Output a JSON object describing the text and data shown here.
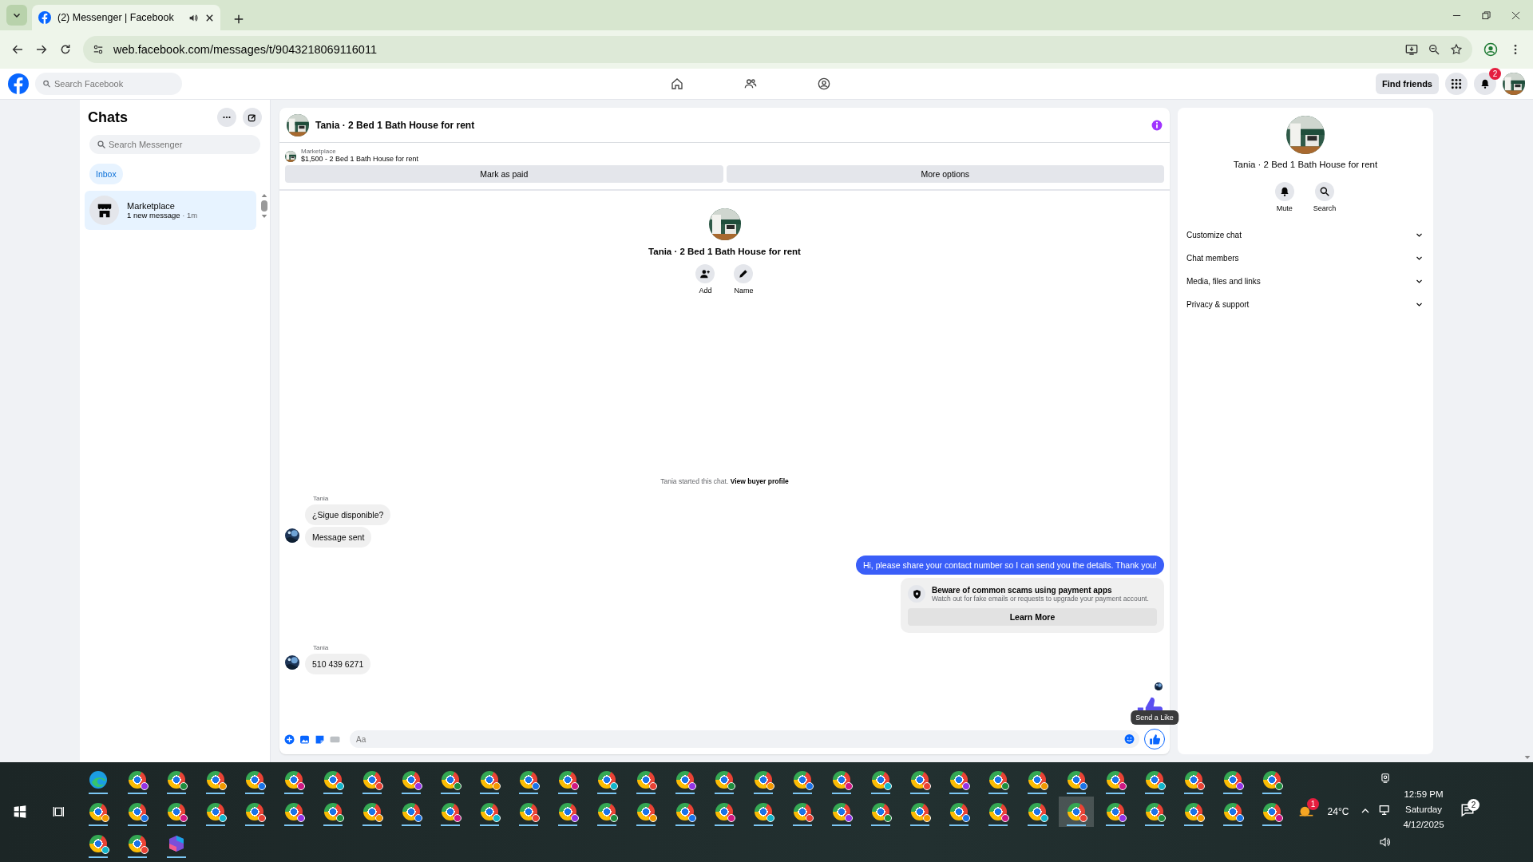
{
  "browser": {
    "tab_title": "(2) Messenger | Facebook",
    "address": "web.facebook.com/messages/t/9043218069116011"
  },
  "facebook_nav": {
    "search_placeholder": "Search Facebook",
    "find_friends": "Find friends",
    "notification_count": "2"
  },
  "chats": {
    "title": "Chats",
    "search_placeholder": "Search Messenger",
    "filters": [
      {
        "label": "Inbox",
        "selected": true
      }
    ],
    "items": [
      {
        "name": "Marketplace",
        "preview": "1 new message",
        "time": "· 1m",
        "selected": true
      }
    ]
  },
  "conversation": {
    "title": "Tania · 2 Bed 1 Bath House for rent",
    "listing": {
      "source": "Marketplace",
      "title": "$1,500 - 2 Bed 1 Bath House for rent"
    },
    "actions": [
      "Mark as paid",
      "More options"
    ],
    "intro": {
      "name": "Tania · 2 Bed 1 Bath House for rent",
      "actions": [
        {
          "kind": "add",
          "label": "Add"
        },
        {
          "kind": "name",
          "label": "Name"
        }
      ]
    },
    "start_note": {
      "text": "Tania started this chat.",
      "link": "View buyer profile"
    },
    "messages": [
      {
        "kind": "incoming",
        "sender": "Tania",
        "bubbles": [
          "¿Sigue disponible?",
          "Message sent"
        ]
      },
      {
        "kind": "outgoing",
        "text": "Hi, please share your contact number so I can send you the details. Thank you!"
      },
      {
        "kind": "notice",
        "title": "Beware of common scams using payment apps",
        "body": "Watch out for fake emails or requests to upgrade your payment account.",
        "button": "Learn More"
      },
      {
        "kind": "incoming",
        "sender": "Tania",
        "bubbles": [
          "510 439 6271"
        ]
      },
      {
        "kind": "like"
      }
    ],
    "composer": {
      "placeholder": "Aa",
      "tooltip": "Send a Like"
    }
  },
  "details": {
    "name": "Tania · 2 Bed 1 Bath House for rent",
    "actions": [
      {
        "kind": "mute",
        "label": "Mute"
      },
      {
        "kind": "search",
        "label": "Search"
      }
    ],
    "sections": [
      {
        "label": "Customize chat",
        "expanded": false
      },
      {
        "label": "Chat members",
        "expanded": false
      },
      {
        "label": "Media, files and links",
        "expanded": false
      },
      {
        "label": "Privacy & support",
        "expanded": false
      }
    ]
  },
  "taskbar": {
    "apps": [
      {
        "kind": "edge",
        "selected": false
      },
      {
        "kind": "browser",
        "selected": false
      },
      {
        "kind": "browser",
        "selected": false
      },
      {
        "kind": "browser",
        "selected": false
      },
      {
        "kind": "browser",
        "selected": false
      },
      {
        "kind": "browser",
        "selected": false
      },
      {
        "kind": "browser",
        "selected": false
      },
      {
        "kind": "browser",
        "selected": false
      },
      {
        "kind": "browser",
        "selected": false
      },
      {
        "kind": "browser",
        "selected": false
      },
      {
        "kind": "browser",
        "selected": false
      },
      {
        "kind": "browser",
        "selected": false
      },
      {
        "kind": "browser",
        "selected": false
      },
      {
        "kind": "browser",
        "selected": false
      },
      {
        "kind": "browser",
        "selected": false
      },
      {
        "kind": "browser",
        "selected": false
      },
      {
        "kind": "browser",
        "selected": false
      },
      {
        "kind": "browser",
        "selected": false
      },
      {
        "kind": "browser",
        "selected": false
      },
      {
        "kind": "browser",
        "selected": false
      },
      {
        "kind": "browser",
        "selected": false
      },
      {
        "kind": "browser",
        "selected": false
      },
      {
        "kind": "browser",
        "selected": false
      },
      {
        "kind": "browser",
        "selected": false
      },
      {
        "kind": "browser",
        "selected": false
      },
      {
        "kind": "browser",
        "selected": false
      },
      {
        "kind": "browser",
        "selected": false
      },
      {
        "kind": "browser",
        "selected": false
      },
      {
        "kind": "browser",
        "selected": false
      },
      {
        "kind": "browser",
        "selected": false
      },
      {
        "kind": "browser",
        "selected": false
      },
      {
        "kind": "browser",
        "selected": false
      },
      {
        "kind": "browser",
        "selected": false
      },
      {
        "kind": "browser",
        "selected": false
      },
      {
        "kind": "browser",
        "selected": false
      },
      {
        "kind": "browser",
        "selected": false
      },
      {
        "kind": "browser",
        "selected": false
      },
      {
        "kind": "browser",
        "selected": false
      },
      {
        "kind": "browser",
        "selected": false
      },
      {
        "kind": "browser",
        "selected": false
      },
      {
        "kind": "browser",
        "selected": false
      },
      {
        "kind": "browser",
        "selected": false
      },
      {
        "kind": "browser",
        "selected": false
      },
      {
        "kind": "browser",
        "selected": false
      },
      {
        "kind": "browser",
        "selected": false
      },
      {
        "kind": "browser",
        "selected": false
      },
      {
        "kind": "browser",
        "selected": false
      },
      {
        "kind": "browser",
        "selected": false
      },
      {
        "kind": "browser",
        "selected": false
      },
      {
        "kind": "browser",
        "selected": false
      },
      {
        "kind": "browser",
        "selected": false
      },
      {
        "kind": "browser",
        "selected": false
      },
      {
        "kind": "browser",
        "selected": false
      },
      {
        "kind": "browser",
        "selected": false
      },
      {
        "kind": "browser",
        "selected": false
      },
      {
        "kind": "browser",
        "selected": false
      },
      {
        "kind": "browser",
        "selected": true
      },
      {
        "kind": "browser",
        "selected": false
      },
      {
        "kind": "browser",
        "selected": false
      },
      {
        "kind": "browser",
        "selected": false
      },
      {
        "kind": "browser",
        "selected": false
      },
      {
        "kind": "browser",
        "selected": false
      },
      {
        "kind": "browser",
        "selected": false
      },
      {
        "kind": "browser",
        "selected": false
      },
      {
        "kind": "m365",
        "selected": false
      }
    ],
    "weather": {
      "temperature": "24°C",
      "badge": "1"
    },
    "clock": {
      "time": "12:59 PM",
      "day": "Saturday",
      "date": "4/12/2025"
    },
    "notification_count": "2"
  }
}
